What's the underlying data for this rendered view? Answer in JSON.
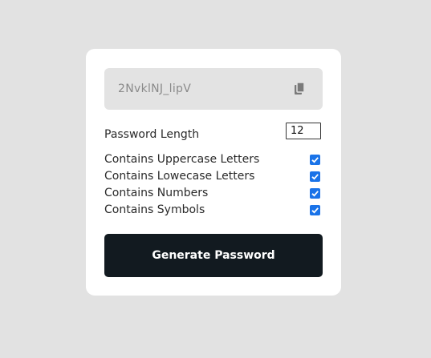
{
  "result": {
    "password": "2NvklNJ_lipV",
    "copy_icon": "clipboard-copy-icon"
  },
  "settings": {
    "length_label": "Password Length",
    "length_value": "12",
    "options": [
      {
        "label": "Contains Uppercase Letters",
        "checked": true
      },
      {
        "label": "Contains Lowecase Letters",
        "checked": true
      },
      {
        "label": "Contains Numbers",
        "checked": true
      },
      {
        "label": "Contains Symbols",
        "checked": true
      }
    ]
  },
  "generate_label": "Generate Password",
  "colors": {
    "background": "#e2e2e2",
    "card": "#ffffff",
    "result_bg": "#e3e3e3",
    "button_bg": "#121a20",
    "checkbox": "#1a73e8"
  }
}
